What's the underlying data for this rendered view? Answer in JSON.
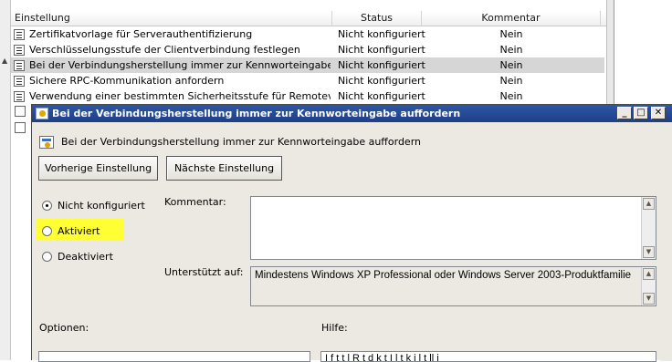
{
  "policy_list": {
    "columns": [
      "Einstellung",
      "Status",
      "Kommentar"
    ],
    "rows": [
      {
        "name": "Zertifikatvorlage für Serverauthentifizierung",
        "status": "Nicht konfiguriert",
        "comment": "Nein"
      },
      {
        "name": "Verschlüsselungsstufe der Clientverbindung festlegen",
        "status": "Nicht konfiguriert",
        "comment": "Nein"
      },
      {
        "name": "Bei der Verbindungsherstellung immer zur Kennworteingabe auffo...",
        "status": "Nicht konfiguriert",
        "comment": "Nein",
        "selected": true
      },
      {
        "name": "Sichere RPC-Kommunikation anfordern",
        "status": "Nicht konfiguriert",
        "comment": "Nein"
      },
      {
        "name": "Verwendung einer bestimmten Sicherheitsstufe für Remoteverbin...",
        "status": "Nicht konfiguriert",
        "comment": "Nein"
      }
    ]
  },
  "dialog": {
    "title": "Bei der Verbindungsherstellung immer zur Kennworteingabe auffordern",
    "header": "Bei der Verbindungsherstellung immer zur Kennworteingabe auffordern",
    "prev_button": "Vorherige Einstellung",
    "next_button": "Nächste Einstellung",
    "radio_options": [
      "Nicht konfiguriert",
      "Aktiviert",
      "Deaktiviert"
    ],
    "selected_option": "Nicht konfiguriert",
    "highlighted_option": "Aktiviert",
    "comment_label": "Kommentar:",
    "comment_value": "",
    "supported_label": "Unterstützt auf:",
    "supported_value": "Mindestens Windows XP Professional oder Windows Server 2003-Produktfamilie",
    "options_label": "Optionen:",
    "help_label": "Hilfe:",
    "help_text_partial": "I    f  t  t  l   R   t  d  k t  I  l  t  k  i  l  t  ll   i"
  },
  "window_buttons": {
    "minimize": "_",
    "maximize": "□",
    "close": "✕"
  },
  "colors": {
    "titlebar": "#1f3f86",
    "highlight": "#ffff33",
    "selected_row": "#d6d6d6",
    "dialog_bg": "#ece9e2"
  }
}
